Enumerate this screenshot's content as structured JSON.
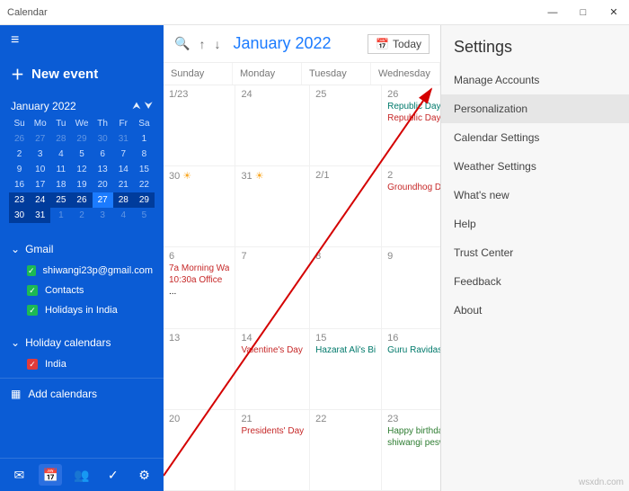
{
  "titlebar": {
    "title": "Calendar",
    "min": "—",
    "max": "□",
    "close": "✕"
  },
  "sidebar": {
    "newevent": "New event",
    "mini": {
      "month": "January 2022",
      "days": [
        "Su",
        "Mo",
        "Tu",
        "We",
        "Th",
        "Fr",
        "Sa"
      ]
    },
    "groups": [
      {
        "name": "Gmail",
        "items": [
          {
            "label": "shiwangi23p@gmail.com",
            "color": "green"
          },
          {
            "label": "Contacts",
            "color": "green"
          },
          {
            "label": "Holidays in India",
            "color": "green"
          }
        ]
      },
      {
        "name": "Holiday calendars",
        "items": [
          {
            "label": "India",
            "color": "red"
          }
        ]
      }
    ],
    "addcal": "Add calendars"
  },
  "toolbar": {
    "title": "January 2022",
    "today": "Today"
  },
  "weekhdr": [
    "Sunday",
    "Monday",
    "Tuesday",
    "Wednesday"
  ],
  "cells": [
    {
      "d": "1/23"
    },
    {
      "d": "24"
    },
    {
      "d": "25"
    },
    {
      "d": "26",
      "events": [
        [
          "Republic Day",
          "teal"
        ],
        [
          "Republic Day",
          "red"
        ]
      ]
    },
    {
      "d": "30",
      "sunny": true
    },
    {
      "d": "31",
      "sunny": true
    },
    {
      "d": "2/1"
    },
    {
      "d": "2",
      "events": [
        [
          "Groundhog Day",
          "red"
        ]
      ]
    },
    {
      "d": "6",
      "events": [
        [
          "7a Morning Wa",
          "red"
        ],
        [
          "10:30a Office",
          "red"
        ]
      ]
    },
    {
      "d": "7"
    },
    {
      "d": "8"
    },
    {
      "d": "9"
    },
    {
      "d": "13"
    },
    {
      "d": "14",
      "events": [
        [
          "Valentine's Day",
          "red"
        ]
      ]
    },
    {
      "d": "15",
      "events": [
        [
          "Hazarat Ali's Bi",
          "teal"
        ]
      ]
    },
    {
      "d": "16",
      "events": [
        [
          "Guru Ravidas Ja",
          "teal"
        ]
      ]
    },
    {
      "d": "20"
    },
    {
      "d": "21",
      "events": [
        [
          "Presidents' Day",
          "red"
        ]
      ]
    },
    {
      "d": "22"
    },
    {
      "d": "23",
      "events": [
        [
          "Happy birthday",
          "green"
        ],
        [
          "shiwangi peswa",
          "green"
        ]
      ]
    }
  ],
  "settings": {
    "title": "Settings",
    "items": [
      "Manage Accounts",
      "Personalization",
      "Calendar Settings",
      "Weather Settings",
      "What's new",
      "Help",
      "Trust Center",
      "Feedback",
      "About"
    ]
  },
  "watermark": "wsxdn.com"
}
